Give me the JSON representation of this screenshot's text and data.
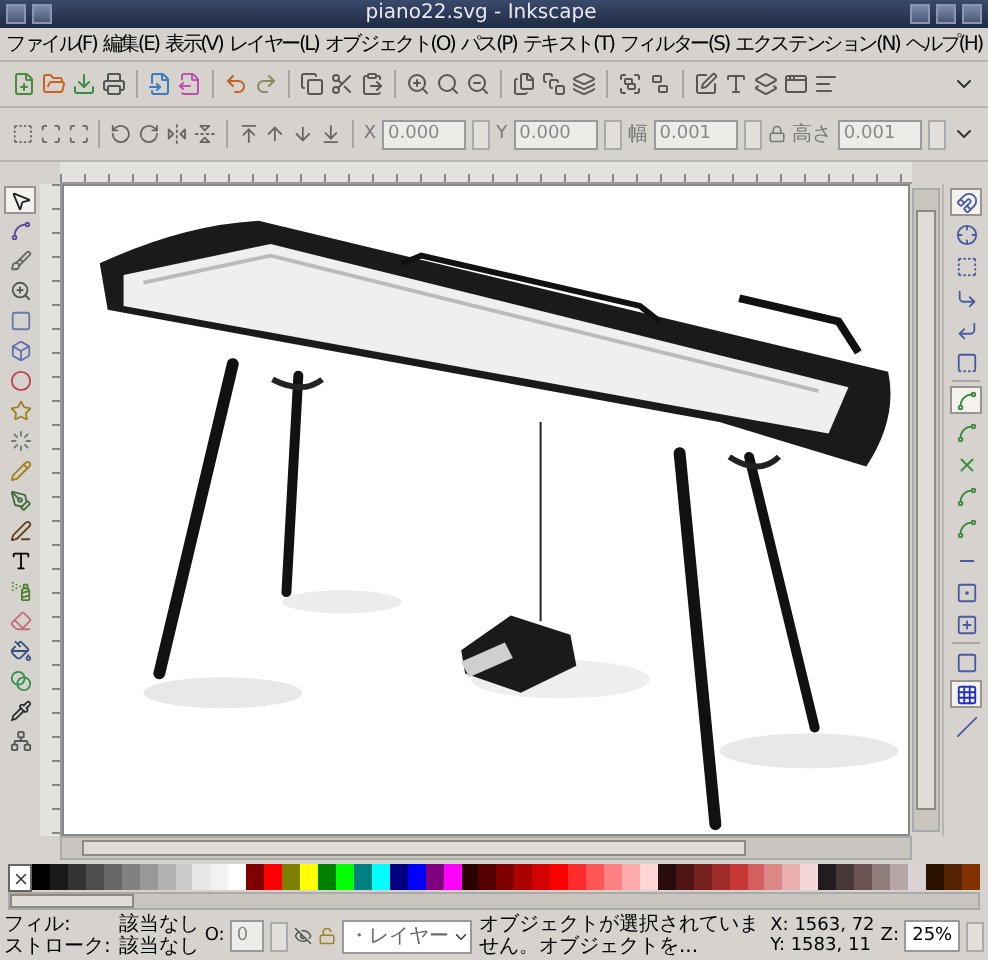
{
  "window": {
    "title": "piano22.svg - Inkscape"
  },
  "menu": [
    "ファイル(F)",
    "編集(E)",
    "表示(V)",
    "レイヤー(L)",
    "オブジェクト(O)",
    "パス(P)",
    "テキスト(T)",
    "フィルター(S)",
    "エクステンション(N)",
    "ヘルプ(H)"
  ],
  "tool_controls": [
    {
      "label": "X",
      "value": "0.000"
    },
    {
      "label": "Y",
      "value": "0.000"
    },
    {
      "label": "幅",
      "value": "0.001"
    },
    {
      "label": "高さ",
      "value": "0.001"
    }
  ],
  "tools": [
    {
      "selected": true
    },
    {
      "selected": false
    },
    {
      "selected": false
    },
    {
      "selected": false
    },
    {
      "selected": false
    },
    {
      "selected": false
    },
    {
      "selected": false
    },
    {
      "selected": false
    },
    {
      "selected": false
    },
    {
      "selected": false
    },
    {
      "selected": false
    },
    {
      "selected": false
    },
    {
      "selected": false
    },
    {
      "selected": false
    },
    {
      "selected": false
    },
    {
      "selected": false
    },
    {
      "selected": false
    },
    {
      "selected": false
    },
    {
      "selected": false
    }
  ],
  "snap_controls": [
    {
      "selected": true
    },
    {
      "selected": false
    },
    {
      "selected": false
    },
    {
      "selected": false
    },
    {
      "selected": false
    },
    {
      "selected": false
    },
    {
      "selected": true
    },
    {
      "selected": false
    },
    {
      "selected": false
    },
    {
      "selected": false
    },
    {
      "selected": false
    },
    {
      "selected": false
    },
    {
      "selected": false
    },
    {
      "selected": false
    },
    {
      "selected": false
    },
    {
      "selected": true
    },
    {
      "selected": false
    }
  ],
  "palette": [
    {
      "color": "#000000"
    },
    {
      "color": "#1a1a1a"
    },
    {
      "color": "#333333"
    },
    {
      "color": "#4d4d4d"
    },
    {
      "color": "#666666"
    },
    {
      "color": "#808080"
    },
    {
      "color": "#999999"
    },
    {
      "color": "#b3b3b3"
    },
    {
      "color": "#cccccc"
    },
    {
      "color": "#e6e6e6"
    },
    {
      "color": "#f2f2f2"
    },
    {
      "color": "#ffffff"
    },
    {
      "color": "#800000"
    },
    {
      "color": "#ff0000"
    },
    {
      "color": "#808000"
    },
    {
      "color": "#ffff00"
    },
    {
      "color": "#008000"
    },
    {
      "color": "#00ff00"
    },
    {
      "color": "#008080"
    },
    {
      "color": "#00ffff"
    },
    {
      "color": "#000080"
    },
    {
      "color": "#0000ff"
    },
    {
      "color": "#800080"
    },
    {
      "color": "#ff00ff"
    },
    {
      "color": "#2b0000"
    },
    {
      "color": "#550000"
    },
    {
      "color": "#800000"
    },
    {
      "color": "#aa0000"
    },
    {
      "color": "#d40000"
    },
    {
      "color": "#ff0000"
    },
    {
      "color": "#ff2a2a"
    },
    {
      "color": "#ff5555"
    },
    {
      "color": "#ff8080"
    },
    {
      "color": "#ffaaaa"
    },
    {
      "color": "#ffd5d5"
    },
    {
      "color": "#280b0b"
    },
    {
      "color": "#501616"
    },
    {
      "color": "#782121"
    },
    {
      "color": "#a02c2c"
    },
    {
      "color": "#c83737"
    },
    {
      "color": "#d35f5f"
    },
    {
      "color": "#de8787"
    },
    {
      "color": "#e9afaf"
    },
    {
      "color": "#f4d7d7"
    },
    {
      "color": "#241c1c"
    },
    {
      "color": "#483737"
    },
    {
      "color": "#6c5353"
    },
    {
      "color": "#917c7c"
    },
    {
      "color": "#b7a6a6"
    },
    {
      "color": "#dbd3d3"
    },
    {
      "color": "#2b1100"
    },
    {
      "color": "#552200"
    },
    {
      "color": "#803300"
    }
  ],
  "status_bar": {
    "fill_label": "フィル:",
    "fill_value": "該当なし",
    "stroke_label": "ストローク:",
    "stroke_value": "該当なし",
    "opacity_label": "O:",
    "opacity_value": "0",
    "layer": "・レイヤー",
    "message": "オブジェクトが選択されていません。オブジェクトを...",
    "cursor_x": "X: 1563, 72",
    "cursor_y": "Y: 1583, 11",
    "zoom_label": "Z:",
    "zoom_value": "25%"
  }
}
